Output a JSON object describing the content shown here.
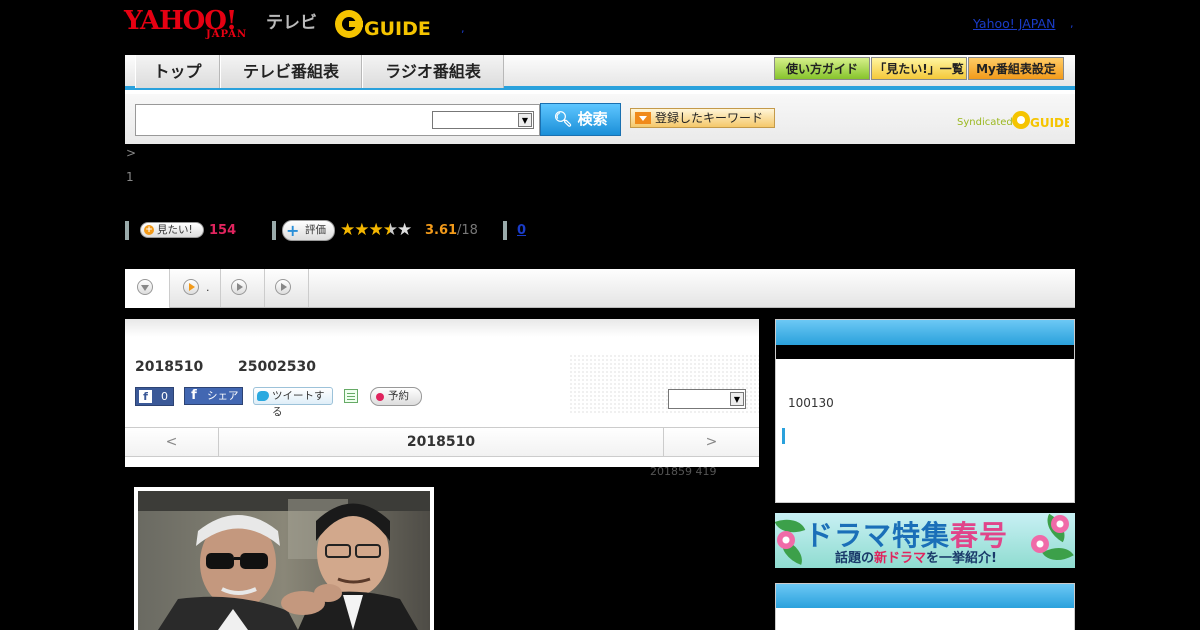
{
  "header": {
    "logo_main": "YAHOO!",
    "logo_sub": "JAPAN",
    "service_name": "テレビ",
    "gguide_logo": "GUIDE",
    "separator": ",",
    "yahoo_link": "Yahoo! JAPAN",
    "yahoo_link_suffix": ","
  },
  "nav": {
    "tabs": [
      {
        "label": "トップ"
      },
      {
        "label": "テレビ番組表"
      },
      {
        "label": "ラジオ番組表"
      }
    ],
    "buttons": [
      {
        "label": "使い方ガイド",
        "color": "#86c42c"
      },
      {
        "label": "「見たい!」一覧",
        "color": "#f4c93a"
      },
      {
        "label": "My番組表設定",
        "color": "#f29a1a"
      }
    ],
    "accent": "#2aa1dc"
  },
  "search": {
    "value": "",
    "select_value": "",
    "button_label": "検索",
    "keyword_button_label": "登録したキーワード",
    "syndicated_text": "Syndicated",
    "syndicated_logo": "GUIDE"
  },
  "breadcrumb": ">",
  "episode_number": "1",
  "stats": {
    "mitai_label": "見たい!",
    "mitai_count": "154",
    "hyoka_label": "評価",
    "rating_value": 3.61,
    "rating_text": "3.61",
    "rating_count": "/18",
    "review_count": "0"
  },
  "subtabs": [
    {
      "icon": "triangle-down-icon",
      "label": ""
    },
    {
      "icon": "play-orange-icon",
      "label": "."
    },
    {
      "icon": "play-icon",
      "label": ""
    },
    {
      "icon": "play-icon",
      "label": ""
    }
  ],
  "program": {
    "date": "2018510",
    "time": "25002530",
    "fb_like_count": "0",
    "fb_share_label": "シェア",
    "tweet_label": "ツイートする",
    "yoyaku_label": "予約",
    "select_value": "",
    "daynav": {
      "prev": "<",
      "current": "2018510",
      "next": ">"
    },
    "update_info": "201859  419"
  },
  "sidebar": {
    "count_text": "100130"
  },
  "banner": {
    "title_part1": "ドラマ特集",
    "title_part2": "春号",
    "sub_part1": "話題の",
    "sub_part2": "新ドラマ",
    "sub_part3": "を一挙紹介!"
  },
  "colors": {
    "brand_red": "#e60012",
    "link_blue": "#1a3cc8",
    "pink": "#e0245e",
    "orange": "#f29a1a",
    "header_blue": "#2aa1dc"
  }
}
